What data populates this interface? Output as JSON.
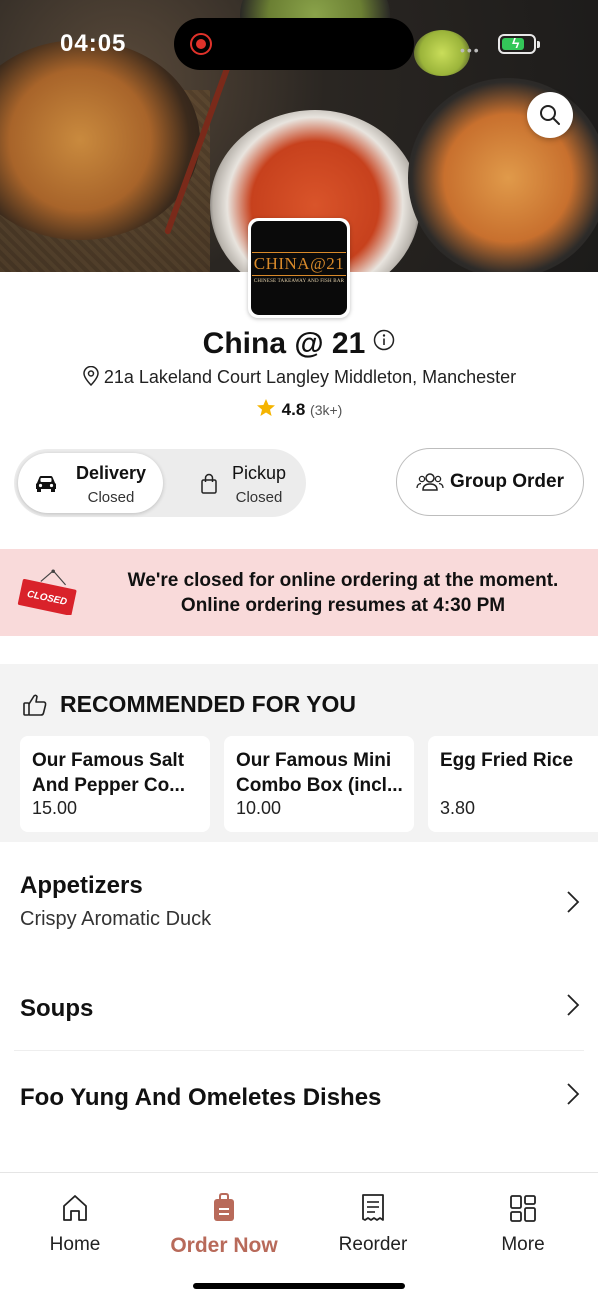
{
  "status_bar": {
    "time": "04:05"
  },
  "restaurant": {
    "logo_text": "CHINA@21",
    "logo_subtext": "CHINESE TAKEAWAY AND FISH BAR",
    "name": "China @ 21",
    "address": "21a Lakeland Court Langley Middleton, Manchester",
    "rating": "4.8",
    "rating_count": "(3k+)"
  },
  "order_mode": {
    "delivery": {
      "label": "Delivery",
      "status": "Closed",
      "selected": true
    },
    "pickup": {
      "label": "Pickup",
      "status": "Closed",
      "selected": false
    }
  },
  "group_order_label": "Group Order",
  "closed_banner": {
    "sign_text": "CLOSED",
    "line1": "We're closed for online ordering at the moment.",
    "line2": "Online ordering resumes at 4:30 PM"
  },
  "recommended": {
    "title": "RECOMMENDED FOR YOU",
    "items": [
      {
        "name": "Our Famous Salt And Pepper Co...",
        "price": "15.00"
      },
      {
        "name": "Our Famous Mini Combo Box (incl...",
        "price": "10.00"
      },
      {
        "name": "Egg Fried Rice",
        "price": "3.80"
      }
    ]
  },
  "categories": [
    {
      "title": "Appetizers",
      "description": "Crispy Aromatic Duck"
    },
    {
      "title": "Soups",
      "description": ""
    },
    {
      "title": "Foo Yung And Omeletes Dishes",
      "description": ""
    }
  ],
  "bottom_nav": {
    "items": [
      {
        "label": "Home",
        "icon": "home-icon",
        "active": false
      },
      {
        "label": "Order Now",
        "icon": "order-bag-icon",
        "active": true
      },
      {
        "label": "Reorder",
        "icon": "receipt-icon",
        "active": false
      },
      {
        "label": "More",
        "icon": "grid-icon",
        "active": false
      }
    ]
  },
  "colors": {
    "accent": "#b86a5a",
    "closed_banner_bg": "#f9dada",
    "star": "#f5b400",
    "closed_sign": "#d9222a"
  }
}
